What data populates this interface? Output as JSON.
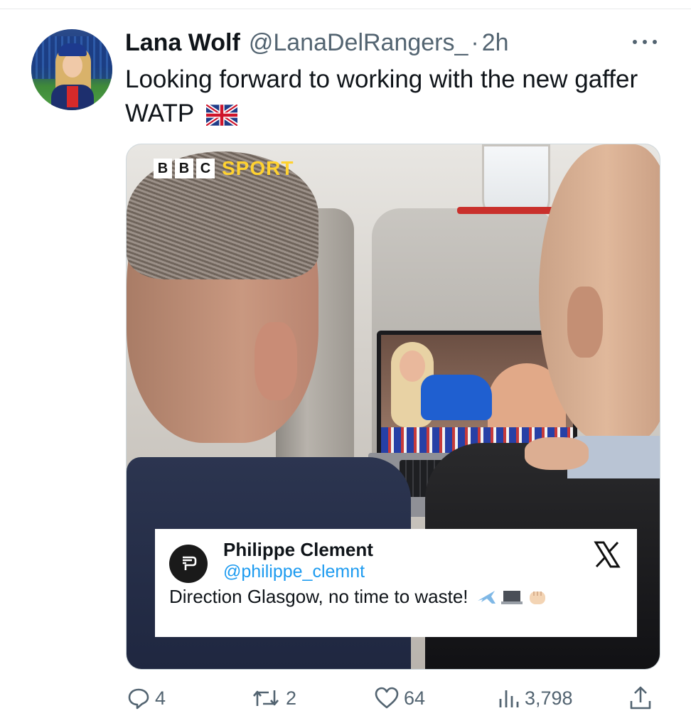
{
  "tweet": {
    "author_name": "Lana Wolf",
    "author_handle": "@LanaDelRangers_",
    "separator": "·",
    "timestamp": "2h",
    "text": "Looking forward to working with the new gaffer WATP",
    "text_emoji": "uk-flag-icon"
  },
  "media": {
    "brand_letters": [
      "B",
      "B",
      "C"
    ],
    "brand_word": "SPORT",
    "quote_card": {
      "name": "Philippe Clement",
      "handle": "@philippe_clemnt",
      "text": "Direction Glasgow, no time to waste!",
      "emojis": [
        "airplane-icon",
        "laptop-icon",
        "fist-icon"
      ],
      "platform_icon": "x-logo-icon"
    }
  },
  "actions": {
    "replies": "4",
    "retweets": "2",
    "likes": "64",
    "views": "3,798"
  },
  "colors": {
    "handle_gray": "#536471",
    "link_blue": "#1d9bf0",
    "bbc_sport_yellow": "#ffd230"
  }
}
